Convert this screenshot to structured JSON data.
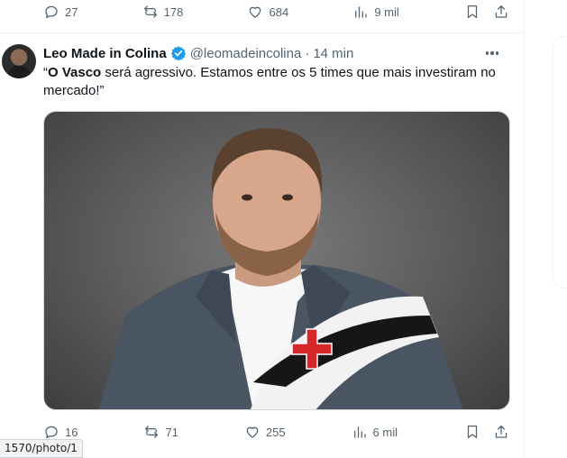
{
  "prev_tweet": {
    "replies": "27",
    "reposts": "178",
    "likes": "684",
    "views": "9 mil"
  },
  "tweet": {
    "display_name": "Leo Made in Colina",
    "handle": "@leomadeincolina",
    "separator": "·",
    "time": "14 min",
    "text_open_quote": "“",
    "text_bold": "O Vasco",
    "text_rest": " será agressivo. Estamos entre os 5 times que mais investiram no mercado!”",
    "replies": "16",
    "reposts": "71",
    "likes": "255",
    "views": "6 mil"
  },
  "status_bar": {
    "url": "1570/photo/1"
  },
  "colors": {
    "muted": "#536471",
    "verified": "#1d9bf0",
    "text": "#0f1419",
    "cross": "#d62828"
  },
  "icons": [
    "reply-icon",
    "repost-icon",
    "like-icon",
    "views-icon",
    "bookmark-icon",
    "share-icon",
    "verified-badge-icon",
    "more-icon"
  ]
}
